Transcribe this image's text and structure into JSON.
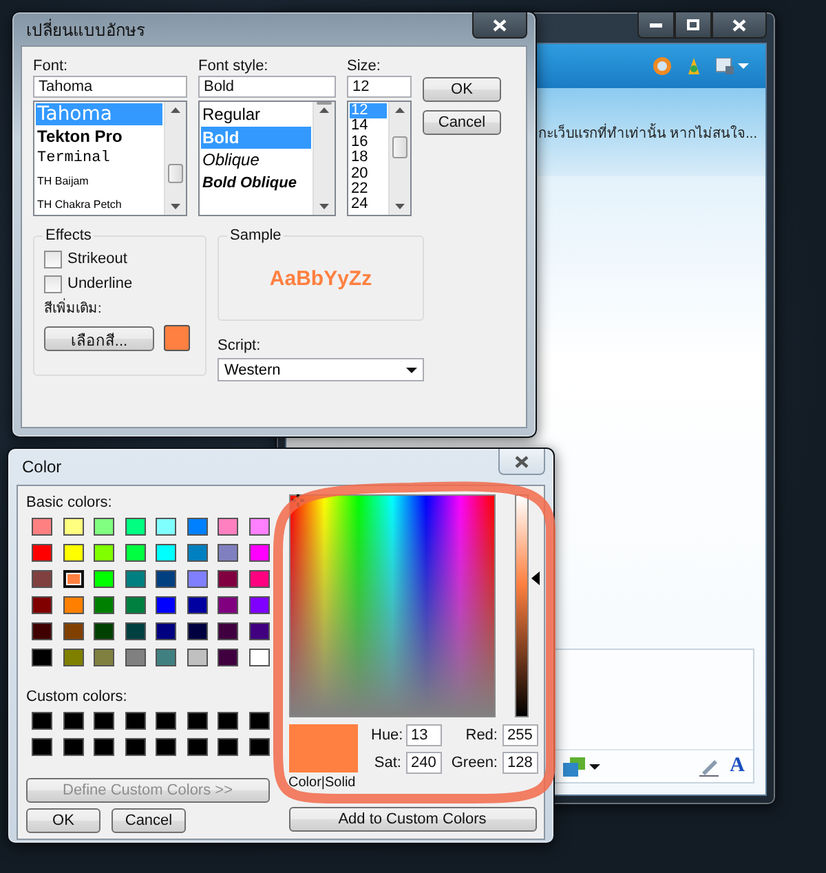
{
  "messenger": {
    "message": "กะเว็บแรกที่ทำเท่านั้น หากไม่สนใจ...",
    "font_button": "A"
  },
  "font_dialog": {
    "title": "เปลี่ยนแบบอักษร",
    "font": {
      "label": "Font:",
      "value": "Tahoma",
      "items": [
        {
          "label": "Tahoma",
          "kind": "sans",
          "selected": true
        },
        {
          "label": "Tekton Pro",
          "kind": "bold",
          "selected": false
        },
        {
          "label": "Terminal",
          "kind": "mono",
          "selected": false
        },
        {
          "label": "TH Baijam",
          "kind": "small",
          "selected": false
        },
        {
          "label": "TH Chakra Petch",
          "kind": "small",
          "selected": false
        }
      ]
    },
    "style": {
      "label": "Font style:",
      "value": "Bold",
      "items": [
        {
          "label": "Regular",
          "kind": "regular",
          "selected": false
        },
        {
          "label": "Bold",
          "kind": "bold",
          "selected": true
        },
        {
          "label": "Oblique",
          "kind": "italic",
          "selected": false
        },
        {
          "label": "Bold Oblique",
          "kind": "bold-italic",
          "selected": false
        }
      ]
    },
    "size": {
      "label": "Size:",
      "value": "12",
      "items": [
        {
          "label": "12",
          "selected": true
        },
        {
          "label": "14",
          "selected": false
        },
        {
          "label": "16",
          "selected": false
        },
        {
          "label": "18",
          "selected": false
        },
        {
          "label": "20",
          "selected": false
        },
        {
          "label": "22",
          "selected": false
        },
        {
          "label": "24",
          "selected": false
        }
      ]
    },
    "buttons": [
      "OK",
      "Cancel"
    ],
    "effects": {
      "title": "Effects",
      "options": [
        {
          "label": "Strikeout",
          "checked": false
        },
        {
          "label": "Underline",
          "checked": false
        }
      ]
    },
    "color_label": "สีเพิ่มเติม:",
    "color_button": "เลือกสี...",
    "color": "#ff8040",
    "sample": {
      "title": "Sample",
      "text": "AaBbYyZz"
    },
    "script": {
      "label": "Script:",
      "value": "Western"
    }
  },
  "color_dialog": {
    "title": "Color",
    "basic_label": "Basic colors:",
    "basic_colors": [
      {
        "color": "#ff8080",
        "selected": false
      },
      {
        "color": "#ffff80",
        "selected": false
      },
      {
        "color": "#80ff80",
        "selected": false
      },
      {
        "color": "#00ff80",
        "selected": false
      },
      {
        "color": "#80ffff",
        "selected": false
      },
      {
        "color": "#0080ff",
        "selected": false
      },
      {
        "color": "#ff80c0",
        "selected": false
      },
      {
        "color": "#ff80ff",
        "selected": false
      },
      {
        "color": "#ff0000",
        "selected": false
      },
      {
        "color": "#ffff00",
        "selected": false
      },
      {
        "color": "#80ff00",
        "selected": false
      },
      {
        "color": "#00ff40",
        "selected": false
      },
      {
        "color": "#00ffff",
        "selected": false
      },
      {
        "color": "#0080c0",
        "selected": false
      },
      {
        "color": "#8080c0",
        "selected": false
      },
      {
        "color": "#ff00ff",
        "selected": false
      },
      {
        "color": "#804040",
        "selected": false
      },
      {
        "color": "#ff8040",
        "selected": true
      },
      {
        "color": "#00ff00",
        "selected": false
      },
      {
        "color": "#008080",
        "selected": false
      },
      {
        "color": "#004080",
        "selected": false
      },
      {
        "color": "#8080ff",
        "selected": false
      },
      {
        "color": "#800040",
        "selected": false
      },
      {
        "color": "#ff0080",
        "selected": false
      },
      {
        "color": "#800000",
        "selected": false
      },
      {
        "color": "#ff8000",
        "selected": false
      },
      {
        "color": "#008000",
        "selected": false
      },
      {
        "color": "#008040",
        "selected": false
      },
      {
        "color": "#0000ff",
        "selected": false
      },
      {
        "color": "#0000a0",
        "selected": false
      },
      {
        "color": "#800080",
        "selected": false
      },
      {
        "color": "#8000ff",
        "selected": false
      },
      {
        "color": "#400000",
        "selected": false
      },
      {
        "color": "#804000",
        "selected": false
      },
      {
        "color": "#004000",
        "selected": false
      },
      {
        "color": "#004040",
        "selected": false
      },
      {
        "color": "#000080",
        "selected": false
      },
      {
        "color": "#000040",
        "selected": false
      },
      {
        "color": "#400040",
        "selected": false
      },
      {
        "color": "#400080",
        "selected": false
      },
      {
        "color": "#000000",
        "selected": false
      },
      {
        "color": "#808000",
        "selected": false
      },
      {
        "color": "#808040",
        "selected": false
      },
      {
        "color": "#808080",
        "selected": false
      },
      {
        "color": "#408080",
        "selected": false
      },
      {
        "color": "#c0c0c0",
        "selected": false
      },
      {
        "color": "#400040",
        "selected": false
      },
      {
        "color": "#ffffff",
        "selected": false
      }
    ],
    "custom_label": "Custom colors:",
    "custom_colors": [
      {
        "color": "#000000"
      },
      {
        "color": "#000000"
      },
      {
        "color": "#000000"
      },
      {
        "color": "#000000"
      },
      {
        "color": "#000000"
      },
      {
        "color": "#000000"
      },
      {
        "color": "#000000"
      },
      {
        "color": "#000000"
      },
      {
        "color": "#000000"
      },
      {
        "color": "#000000"
      },
      {
        "color": "#000000"
      },
      {
        "color": "#000000"
      },
      {
        "color": "#000000"
      },
      {
        "color": "#000000"
      },
      {
        "color": "#000000"
      },
      {
        "color": "#000000"
      }
    ],
    "define_button": {
      "label": "Define Custom Colors >>",
      "disabled": true
    },
    "buttons": [
      "OK",
      "Cancel"
    ],
    "preview": {
      "label": "Color|Solid",
      "color": "#ff8040"
    },
    "fields": [
      {
        "label": "Hue:",
        "value": "13"
      },
      {
        "label": "Red:",
        "value": "255"
      },
      {
        "label": "Sat:",
        "value": "240"
      },
      {
        "label": "Green:",
        "value": "128"
      }
    ],
    "add_button": "Add to Custom Colors"
  }
}
